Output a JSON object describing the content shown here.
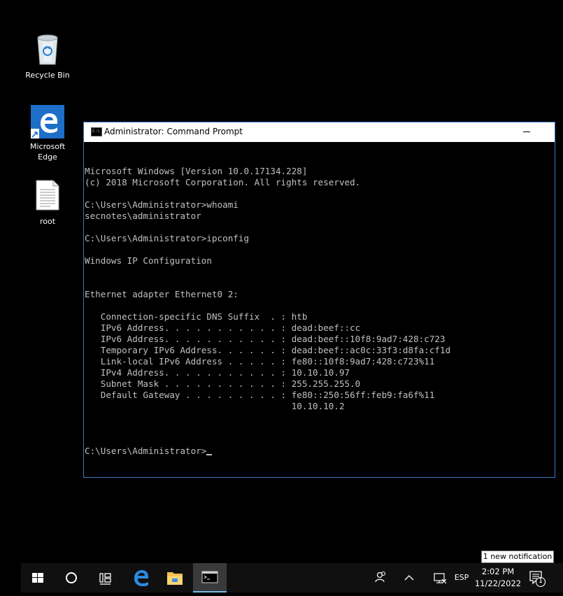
{
  "desktop": {
    "icons": [
      {
        "label": "Recycle Bin"
      },
      {
        "label": "Microsoft Edge"
      },
      {
        "label": "root"
      }
    ]
  },
  "cmd_window": {
    "title": "Administrator: Command Prompt",
    "lines": [
      "Microsoft Windows [Version 10.0.17134.228]",
      "(c) 2018 Microsoft Corporation. All rights reserved.",
      "",
      "C:\\Users\\Administrator>whoami",
      "secnotes\\administrator",
      "",
      "C:\\Users\\Administrator>ipconfig",
      "",
      "Windows IP Configuration",
      "",
      "",
      "Ethernet adapter Ethernet0 2:",
      "",
      "   Connection-specific DNS Suffix  . : htb",
      "   IPv6 Address. . . . . . . . . . . : dead:beef::cc",
      "   IPv6 Address. . . . . . . . . . . : dead:beef::10f8:9ad7:428:c723",
      "   Temporary IPv6 Address. . . . . . : dead:beef::ac0c:33f3:d8fa:cf1d",
      "   Link-local IPv6 Address . . . . . : fe80::10f8:9ad7:428:c723%11",
      "   IPv4 Address. . . . . . . . . . . : 10.10.10.97",
      "   Subnet Mask . . . . . . . . . . . : 255.255.255.0",
      "   Default Gateway . . . . . . . . . : fe80::250:56ff:feb9:fa6f%11",
      "                                       10.10.10.2",
      ""
    ],
    "prompt": "C:\\Users\\Administrator>"
  },
  "notification": {
    "text": "1 new notification"
  },
  "taskbar": {
    "language": "ESP",
    "time": "2:02 PM",
    "date": "11/22/2022",
    "notification_count": "1"
  },
  "colors": {
    "console_text": "#c0c0c0",
    "window_border": "#3b76c4",
    "edge_blue": "#1e6fc8",
    "taskbar_bg": "#101010"
  }
}
